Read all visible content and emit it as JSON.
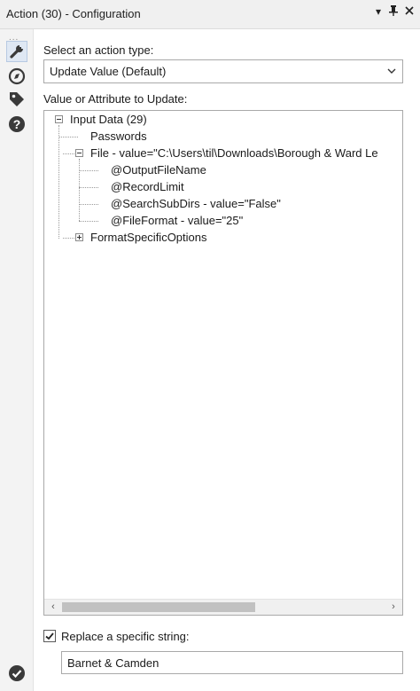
{
  "window": {
    "title": "Action (30) - Configuration",
    "controls": {
      "menu": "▾",
      "pin": "📌",
      "close": "✕"
    }
  },
  "rail": {
    "dots": "...",
    "icons": [
      "wrench-icon",
      "compass-icon",
      "tag-icon",
      "help-icon",
      "check-circle-icon"
    ]
  },
  "action_type": {
    "label": "Select an action type:",
    "selected": "Update Value (Default)"
  },
  "tree_section": {
    "label": "Value or Attribute to Update:",
    "nodes": [
      "Input Data (29)",
      "Passwords",
      "File - value=\"C:\\Users\\til\\Downloads\\Borough & Ward Le",
      "@OutputFileName",
      "@RecordLimit",
      "@SearchSubDirs - value=\"False\"",
      "@FileFormat - value=\"25\"",
      "FormatSpecificOptions"
    ]
  },
  "replace": {
    "label": "Replace a specific string:",
    "checked": true,
    "value": "Barnet & Camden"
  },
  "colors": {
    "accent": "#2b5fa8",
    "icon_dark": "#3a3a3a",
    "border": "#a9a9a9"
  }
}
